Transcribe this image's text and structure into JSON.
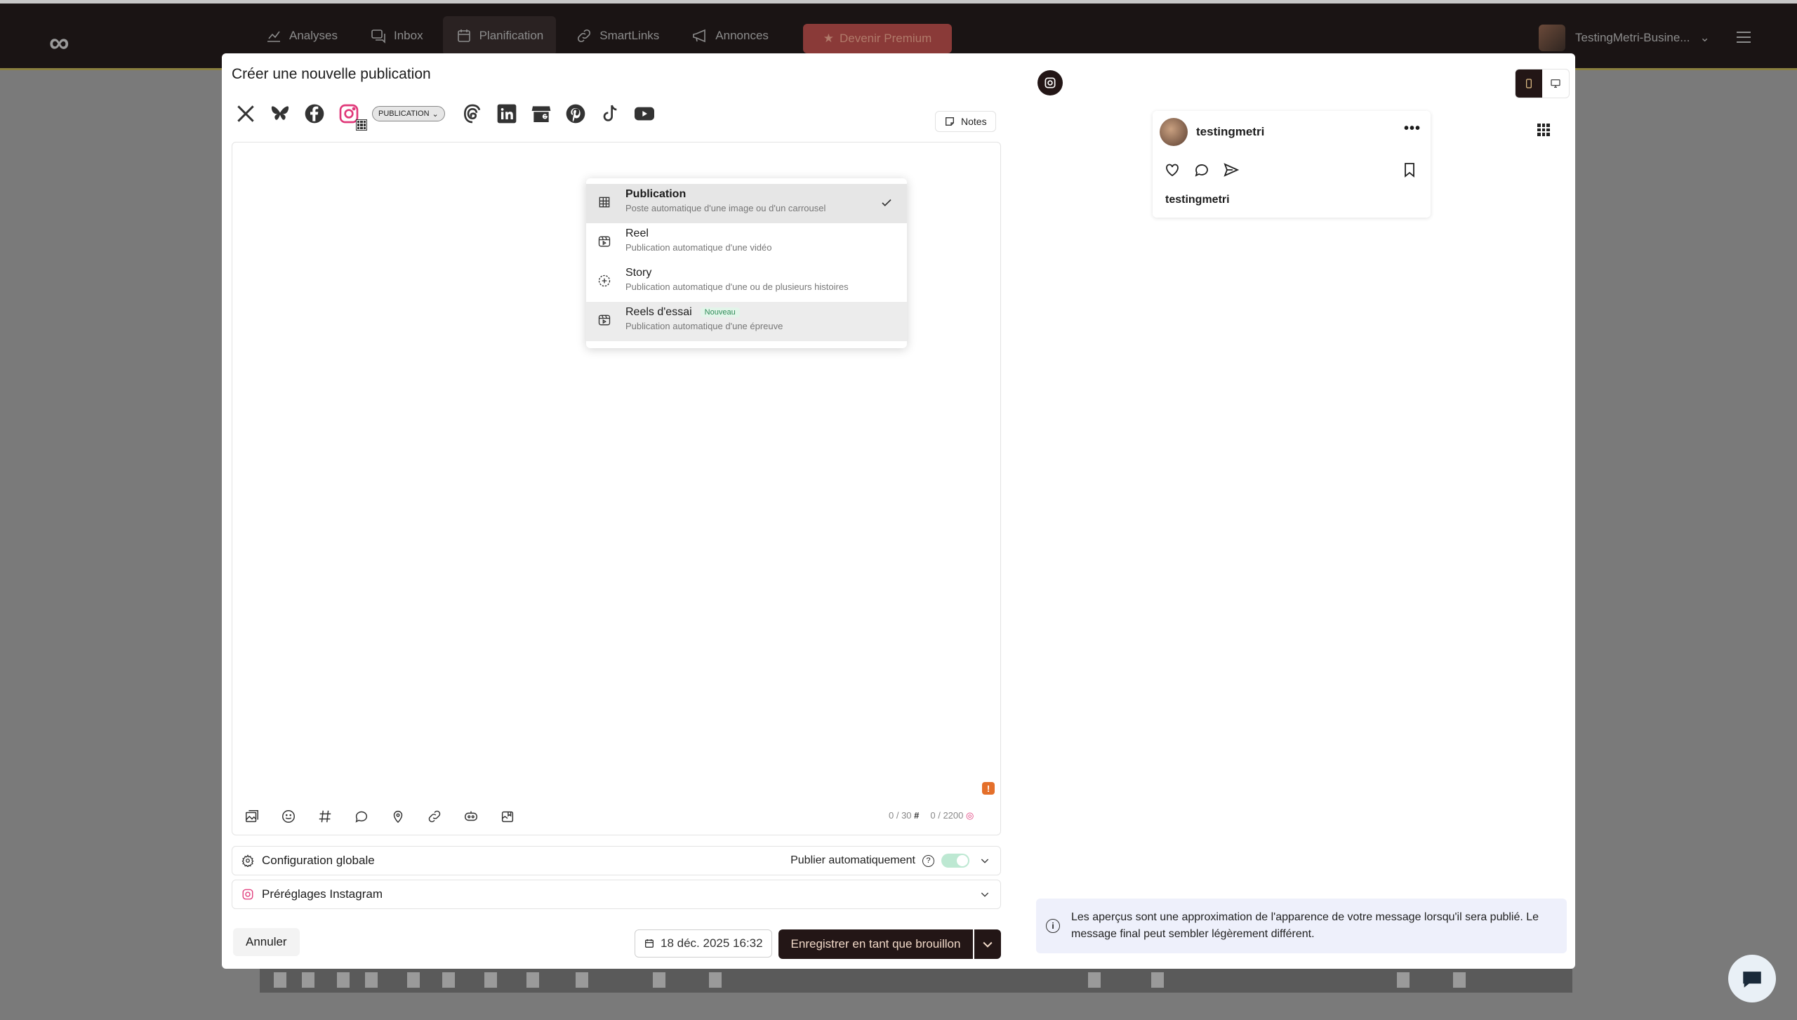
{
  "app": {
    "logo": "∞",
    "nav": [
      {
        "label": "Analyses",
        "icon": "chart-icon",
        "active": false
      },
      {
        "label": "Inbox",
        "icon": "inbox-icon",
        "active": false
      },
      {
        "label": "Planification",
        "icon": "calendar-icon",
        "active": true
      },
      {
        "label": "SmartLinks",
        "icon": "link-icon",
        "active": false
      },
      {
        "label": "Annonces",
        "icon": "megaphone-icon",
        "active": false
      }
    ],
    "premium_label": "Devenir Premium",
    "account_name": "TestingMetri-Busine..."
  },
  "modal": {
    "title": "Créer une nouvelle publication",
    "networks": [
      "x-icon",
      "bluesky-icon",
      "facebook-icon",
      "instagram-icon",
      "threads-icon",
      "linkedin-icon",
      "google-business-icon",
      "pinterest-icon",
      "tiktok-icon",
      "youtube-icon"
    ],
    "type_selector": "PUBLICATION",
    "notes_label": "Notes",
    "dropdown": {
      "items": [
        {
          "title": "Publication",
          "desc": "Poste automatique d'une image ou d'un carrousel",
          "selected": true
        },
        {
          "title": "Reel",
          "desc": "Publication automatique d'une vidéo",
          "selected": false
        },
        {
          "title": "Story",
          "desc": "Publication automatique d'une ou de plusieurs histoires",
          "selected": false
        },
        {
          "title": "Reels d'essai",
          "badge": "Nouveau",
          "desc": "Publication automatique d'une épreuve",
          "selected": false
        }
      ]
    },
    "counters": {
      "hashtags": "0 / 30",
      "chars": "0 / 2200"
    },
    "warning": "!",
    "global_config": {
      "label": "Configuration globale",
      "autopublish_label": "Publier automatiquement",
      "help": "?"
    },
    "presets_label": "Préréglages Instagram",
    "cancel_label": "Annuler",
    "date_label": "18 déc. 2025 16:32",
    "save_label": "Enregistrer en tant que brouillon"
  },
  "preview": {
    "username": "testingmetri",
    "caption_user": "testingmetri",
    "more": "•••",
    "info": "Les aperçus sont une approximation de l'apparence de votre message lorsqu'il sera publié. Le message final peut sembler légèrement différent.",
    "info_icon": "i"
  },
  "colors": {
    "accent_dark": "#231616",
    "instagram": "#e0397a",
    "warning": "#e46f2a",
    "toggle": "#bde8d2"
  }
}
